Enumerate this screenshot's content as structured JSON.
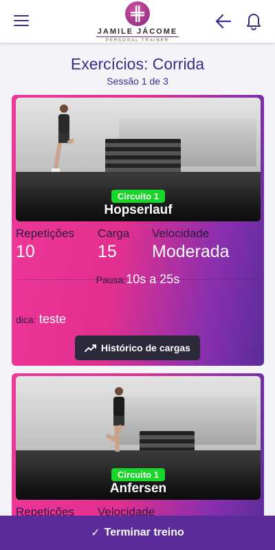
{
  "header": {
    "logo_name": "JAMILE JÁCOME",
    "logo_sub": "PERSONAL TRAINER"
  },
  "page": {
    "title": "Exercícios: Corrida",
    "session": "Sessão 1 de 3"
  },
  "exercises": [
    {
      "circuit": "Circuito 1",
      "name": "Hopserlauf",
      "stats": [
        {
          "label": "Repetições",
          "value": "10"
        },
        {
          "label": "Carga",
          "value": "15"
        },
        {
          "label": "Velocidade",
          "value": "Moderada"
        }
      ],
      "pause_label": "Pausa:",
      "pause_value": "10s a 25s",
      "tip_label": "dica:",
      "tip_value": "teste",
      "history_button": "Histórico de cargas"
    },
    {
      "circuit": "Circuito 1",
      "name": "Anfersen",
      "stats": [
        {
          "label": "Repetições",
          "value": ""
        },
        {
          "label": "Velocidade",
          "value": ""
        }
      ]
    }
  ],
  "footer": {
    "finish_button": "Terminar treino"
  },
  "colors": {
    "primary": "#3a2a8a",
    "pink": "#f0379a",
    "purple": "#5a2c9a",
    "badge_green": "#19d62b"
  },
  "icons": [
    "menu-icon",
    "back-arrow-icon",
    "bell-icon",
    "trending-up-icon",
    "check-icon"
  ]
}
